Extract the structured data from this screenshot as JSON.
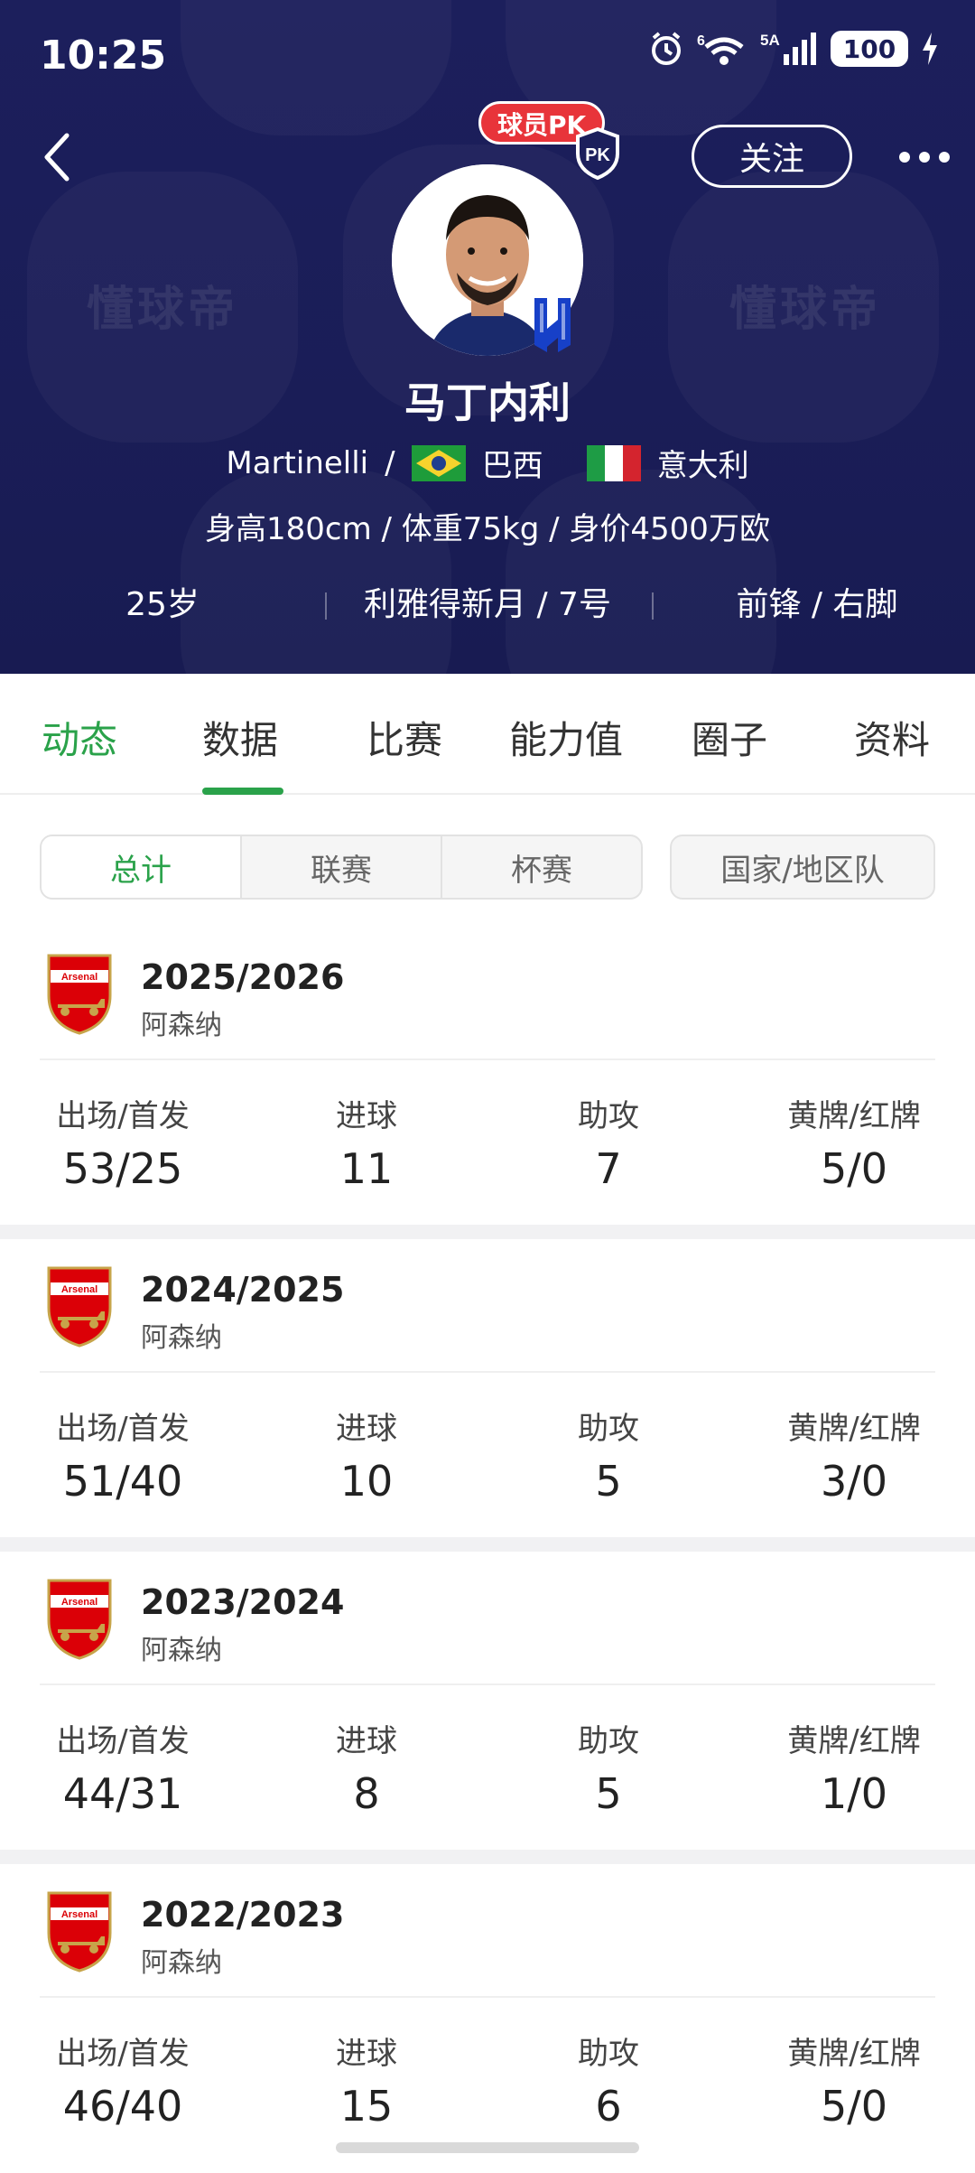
{
  "status": {
    "time": "10:25",
    "signal_label": "6",
    "network": "5A",
    "battery": "100"
  },
  "header": {
    "pk_tag": "球员PK",
    "pk_badge": "PK",
    "follow_label": "关注",
    "watermark": "懂球帝",
    "player_name": "马丁内利",
    "english_name": "Martinelli",
    "sep": "/",
    "nationality_1": "巴西",
    "nationality_2": "意大利",
    "bio": "身高180cm / 体重75kg / 身价4500万欧",
    "age": "25岁",
    "club_number": "利雅得新月 / 7号",
    "position_foot": "前锋 / 右脚"
  },
  "tabs": [
    "动态",
    "数据",
    "比赛",
    "能力值",
    "圈子",
    "资料"
  ],
  "filters": {
    "segments": [
      "总计",
      "联赛",
      "杯赛"
    ],
    "national": "国家/地区队"
  },
  "stat_labels": {
    "apps": "出场/首发",
    "goals": "进球",
    "assists": "助攻",
    "cards": "黄牌/红牌"
  },
  "seasons": [
    {
      "season": "2025/2026",
      "team": "阿森纳",
      "apps": "53/25",
      "goals": "11",
      "assists": "7",
      "cards": "5/0"
    },
    {
      "season": "2024/2025",
      "team": "阿森纳",
      "apps": "51/40",
      "goals": "10",
      "assists": "5",
      "cards": "3/0"
    },
    {
      "season": "2023/2024",
      "team": "阿森纳",
      "apps": "44/31",
      "goals": "8",
      "assists": "5",
      "cards": "1/0"
    },
    {
      "season": "2022/2023",
      "team": "阿森纳",
      "apps": "46/40",
      "goals": "15",
      "assists": "6",
      "cards": "5/0"
    }
  ],
  "colors": {
    "header_bg": "#1c1f5c",
    "accent": "#2aa24a",
    "pk_red": "#e8343a",
    "arsenal_red": "#db0007"
  }
}
